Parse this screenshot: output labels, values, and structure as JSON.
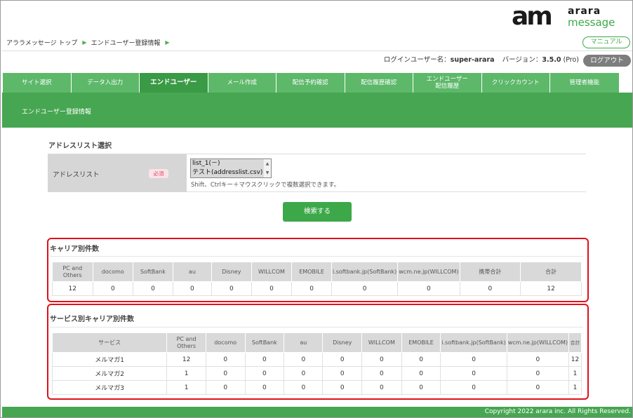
{
  "logo": {
    "mark": "am",
    "word1": "arara",
    "word2": "message"
  },
  "breadcrumb": {
    "items": [
      "アララメッセージ トップ",
      "エンドユーザー登録情報"
    ],
    "separator": "▶"
  },
  "header": {
    "manual_label": "マニュアル",
    "user_prefix": "ログインユーザー名：",
    "user_name": "super-arara",
    "version_prefix": "バージョン：",
    "version": "3.5.0",
    "version_suffix": "(Pro)",
    "logout_label": "ログアウト"
  },
  "tabs": [
    {
      "label": "サイト選択",
      "active": false
    },
    {
      "label": "データ入出力",
      "active": false
    },
    {
      "label": "エンドユーザー",
      "active": true
    },
    {
      "label": "メール作成",
      "active": false
    },
    {
      "label": "配信予約確認",
      "active": false
    },
    {
      "label": "配信履歴確認",
      "active": false
    },
    {
      "label": "エンドユーザー配信履歴",
      "line1": "エンドユーザー",
      "line2": "配信履歴",
      "active": false
    },
    {
      "label": "クリックカウント",
      "active": false
    },
    {
      "label": "管理者機能",
      "active": false
    }
  ],
  "page_title": "エンドユーザー登録情報",
  "address_section": {
    "title": "アドレスリスト選択",
    "label": "アドレスリスト",
    "required_badge": "必須",
    "options": [
      "list_1(－)",
      "テスト(addresslist.csv)"
    ],
    "hint": "Shift、Ctrlキー＋マウスクリックで複数選択できます。"
  },
  "search_label": "検索する",
  "carrier_section": {
    "title": "キャリア別件数",
    "headers": [
      "PC and Others",
      "docomo",
      "SoftBank",
      "au",
      "Disney",
      "WILLCOM",
      "EMOBILE",
      "i.softbank.jp(SoftBank)",
      "wcm.ne.jp(WILLCOM)",
      "携帯合計",
      "合計"
    ],
    "values": [
      "12",
      "0",
      "0",
      "0",
      "0",
      "0",
      "0",
      "0",
      "0",
      "0",
      "12"
    ]
  },
  "service_section": {
    "title": "サービス別キャリア別件数",
    "headers": [
      "サービス",
      "PC and Others",
      "docomo",
      "SoftBank",
      "au",
      "Disney",
      "WILLCOM",
      "EMOBILE",
      "i.softbank.jp(SoftBank)",
      "wcm.ne.jp(WILLCOM)",
      "合計"
    ],
    "rows": [
      [
        "メルマガ1",
        "12",
        "0",
        "0",
        "0",
        "0",
        "0",
        "0",
        "0",
        "0",
        "12"
      ],
      [
        "メルマガ2",
        "1",
        "0",
        "0",
        "0",
        "0",
        "0",
        "0",
        "0",
        "0",
        "1"
      ],
      [
        "メルマガ3",
        "1",
        "0",
        "0",
        "0",
        "0",
        "0",
        "0",
        "0",
        "0",
        "1"
      ]
    ]
  },
  "footer": {
    "copyright": "Copyright 2022 arara inc. All Rights Reserved."
  },
  "colors": {
    "brand_green": "#47a652",
    "tab_green": "#5db86a",
    "active_tab": "#3a9a45",
    "highlight_red": "#e0101a"
  }
}
